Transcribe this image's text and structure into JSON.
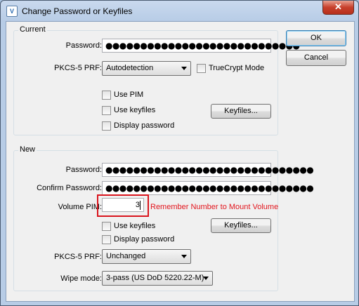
{
  "window": {
    "title": "Change Password or Keyfiles",
    "app_icon_glyph": "V",
    "close_glyph": "✕"
  },
  "buttons": {
    "ok": "OK",
    "cancel": "Cancel"
  },
  "current": {
    "group_title": "Current",
    "password_label": "Password:",
    "password_value": "●●●●●●●●●●●●●●●●●●●●●●●●●●●●",
    "prf_label": "PKCS-5 PRF:",
    "prf_value": "Autodetection",
    "truecrypt_mode": "TrueCrypt Mode",
    "use_pim": "Use PIM",
    "use_keyfiles": "Use keyfiles",
    "display_password": "Display password",
    "keyfiles_button": "Keyfiles..."
  },
  "new": {
    "group_title": "New",
    "password_label": "Password:",
    "password_value": "●●●●●●●●●●●●●●●●●●●●●●●●●●●●●●",
    "confirm_label": "Confirm Password:",
    "confirm_value": "●●●●●●●●●●●●●●●●●●●●●●●●●●●●●●",
    "pim_label": "Volume PIM:",
    "pim_value": "3",
    "pim_hint": "Remember Number to Mount Volume",
    "use_keyfiles": "Use keyfiles",
    "display_password": "Display password",
    "keyfiles_button": "Keyfiles...",
    "prf_label": "PKCS-5 PRF:",
    "prf_value": "Unchanged",
    "wipe_label": "Wipe mode:",
    "wipe_value": "3-pass (US DoD 5220.22-M)"
  },
  "colors": {
    "highlight": "#d9141d",
    "hint_text": "#e2161e"
  }
}
